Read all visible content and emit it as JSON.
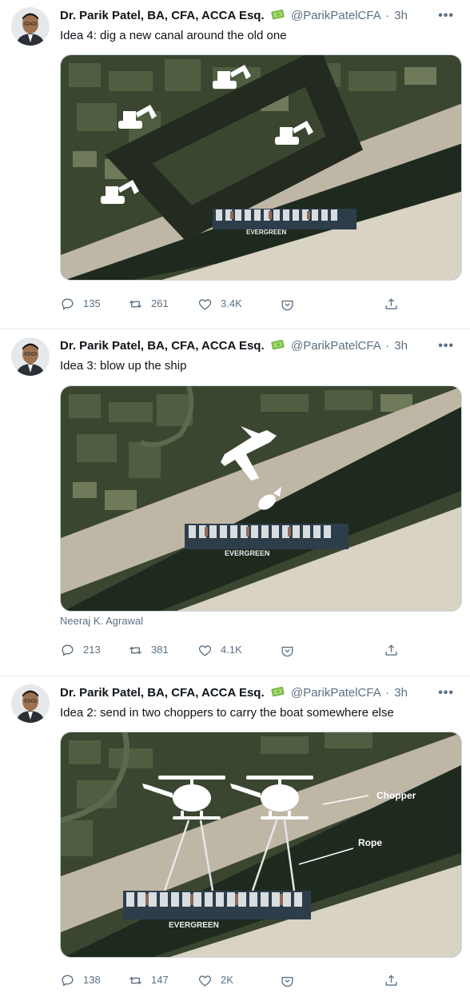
{
  "tweets": [
    {
      "author_name": "Dr. Parik Patel, BA, CFA, ACCA Esq.",
      "author_emoji": "money-bag-emoji",
      "handle": "@ParikPatelCFA",
      "separator": "·",
      "time": "3h",
      "more": "•••",
      "text": "Idea 4: dig a new canal around the old one",
      "image_subject": "dig-new-canal",
      "ship_name": "EVERGREEN",
      "credit": "",
      "replies": "135",
      "retweets": "261",
      "likes": "3.4K"
    },
    {
      "author_name": "Dr. Parik Patel, BA, CFA, ACCA Esq.",
      "author_emoji": "money-bag-emoji",
      "handle": "@ParikPatelCFA",
      "separator": "·",
      "time": "3h",
      "more": "•••",
      "text": "Idea 3: blow up the ship",
      "image_subject": "blow-up-ship",
      "ship_name": "EVERGREEN",
      "credit": "Neeraj K. Agrawal",
      "replies": "213",
      "retweets": "381",
      "likes": "4.1K"
    },
    {
      "author_name": "Dr. Parik Patel, BA, CFA, ACCA Esq.",
      "author_emoji": "money-bag-emoji",
      "handle": "@ParikPatelCFA",
      "separator": "·",
      "time": "3h",
      "more": "•••",
      "text": "Idea 2: send in two choppers to carry the boat somewhere else",
      "image_subject": "choppers-carry-boat",
      "ship_name": "EVERGREEN",
      "annotation_chopper": "Chopper",
      "annotation_rope": "Rope",
      "credit": "",
      "replies": "138",
      "retweets": "147",
      "likes": "2K"
    }
  ],
  "icons": {
    "reply": "reply-icon",
    "retweet": "retweet-icon",
    "like": "like-icon",
    "tip": "tip-jar-icon",
    "share": "share-icon"
  },
  "colors": {
    "text_primary": "#0f1419",
    "text_secondary": "#5b7083",
    "divider": "#e6ecf0",
    "canal_water": "#1f2a1f",
    "sand": "#d9d3c4"
  }
}
